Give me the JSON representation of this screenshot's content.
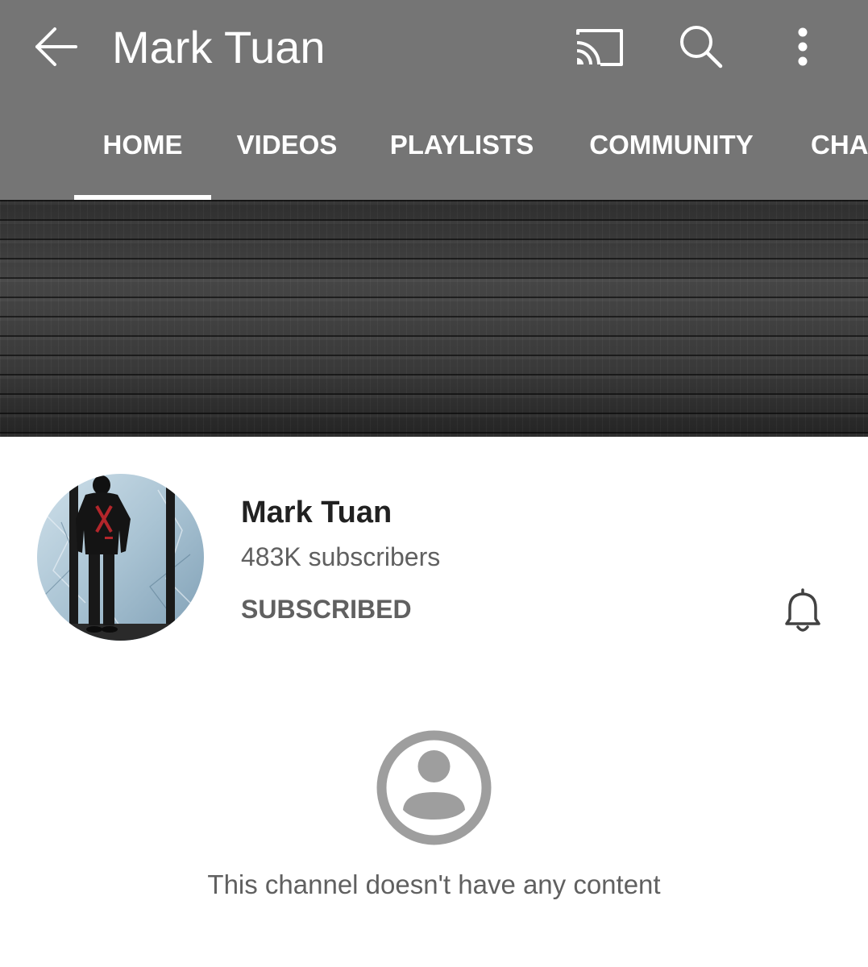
{
  "header": {
    "title": "Mark Tuan",
    "icons": {
      "back": "arrow-back-icon",
      "cast": "cast-icon",
      "search": "search-icon",
      "more": "more-vert-icon"
    }
  },
  "tabs": [
    {
      "label": "HOME",
      "selected": true
    },
    {
      "label": "VIDEOS",
      "selected": false
    },
    {
      "label": "PLAYLISTS",
      "selected": false
    },
    {
      "label": "COMMUNITY",
      "selected": false
    },
    {
      "label": "CHA",
      "selected": false
    }
  ],
  "channel": {
    "name": "Mark Tuan",
    "subscribers": "483K subscribers",
    "subscribe_state": "SUBSCRIBED",
    "notification_icon": "bell-icon"
  },
  "empty_state": {
    "icon": "account-circle-icon",
    "message": "This channel doesn't have any content"
  },
  "colors": {
    "appbar": "#757575",
    "text_primary": "#212121",
    "text_secondary": "#606060",
    "icon_gray": "#9e9e9e"
  }
}
